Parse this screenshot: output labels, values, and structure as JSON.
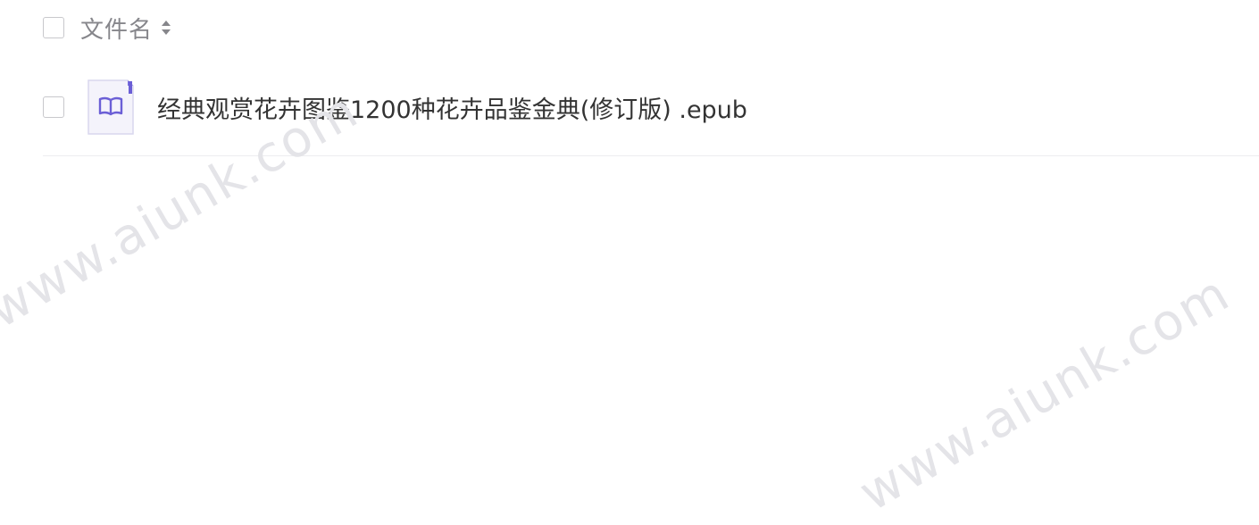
{
  "file_list": {
    "header": {
      "column_label": "文件名"
    },
    "rows": [
      {
        "name": "经典观赏花卉图鉴1200种花卉品鉴金典(修订版) .epub",
        "icon": "book-icon"
      }
    ]
  },
  "watermark": {
    "text": "www.aiunk.com"
  },
  "colors": {
    "icon_accent": "#6b5fd6",
    "icon_bg": "#f4f3fb",
    "header_text": "#86868b",
    "divider": "#ededf0"
  }
}
